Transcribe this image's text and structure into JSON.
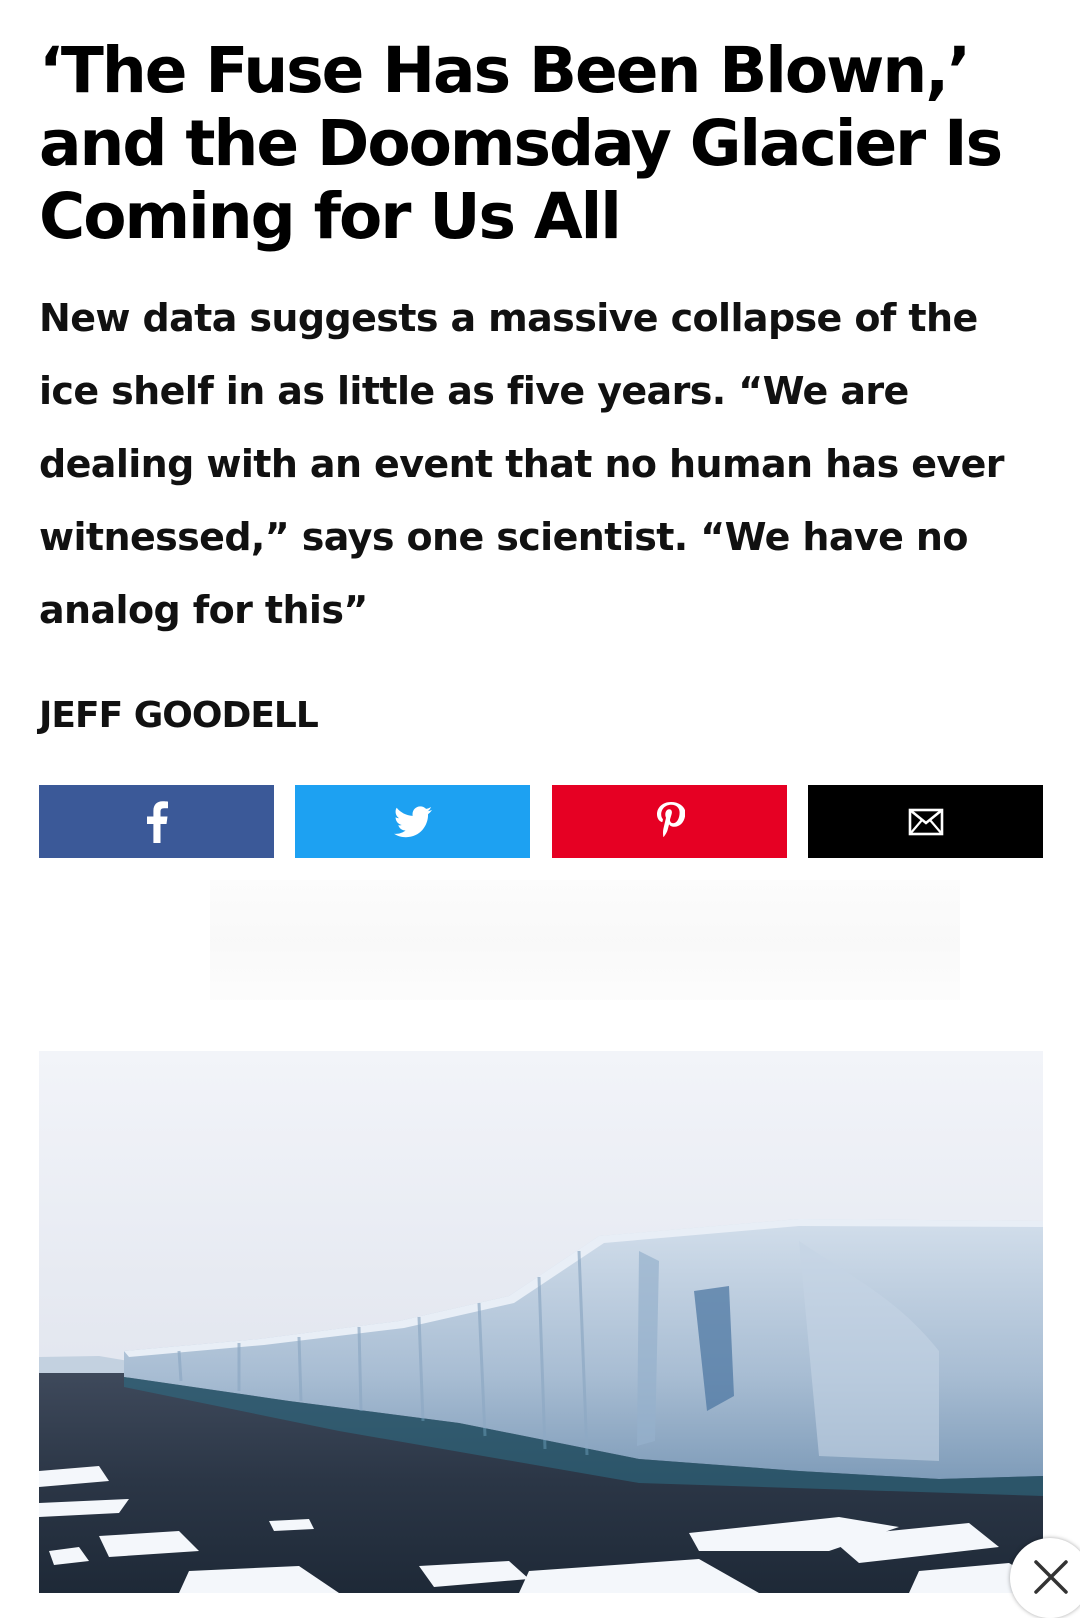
{
  "article": {
    "headline": "‘The Fuse Has Been Blown,’ and the Doomsday Glacier Is Coming for Us All",
    "dek": "New data suggests a massive collapse of the ice shelf in as little as five years. “We are dealing with an event that no human has ever witnessed,” says one scientist. “We have no analog for this”",
    "author": "JEFF GOODELL"
  },
  "share": {
    "buttons": [
      {
        "network": "facebook",
        "icon": "facebook-icon",
        "color": "#3b5998"
      },
      {
        "network": "twitter",
        "icon": "twitter-bird-icon",
        "color": "#1da1f2"
      },
      {
        "network": "pinterest",
        "icon": "pinterest-icon",
        "color": "#e60023"
      },
      {
        "network": "email",
        "icon": "envelope-icon",
        "color": "#000000"
      }
    ]
  },
  "hero_image": {
    "subject": "Antarctic ice shelf cliff above dark sea with floating ice"
  },
  "overlay": {
    "close_icon": "close-icon"
  }
}
